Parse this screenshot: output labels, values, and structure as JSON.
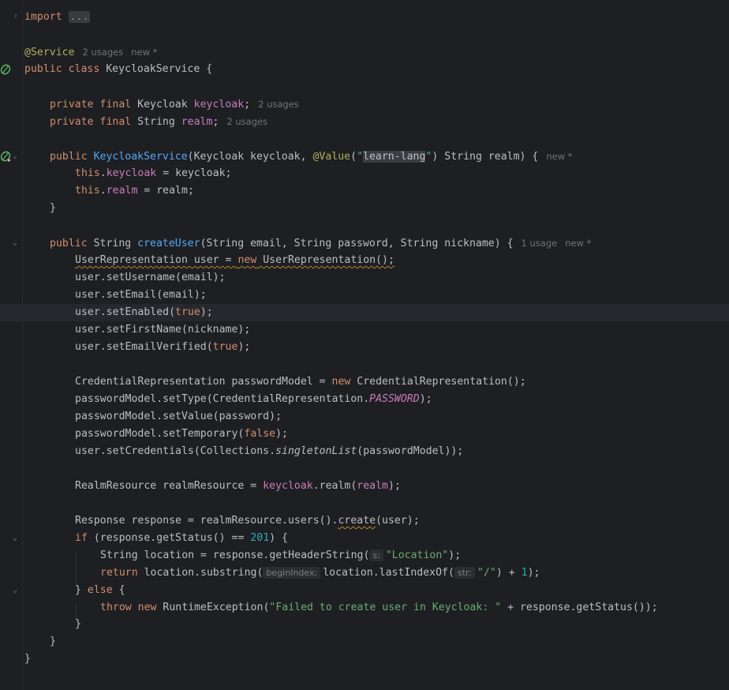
{
  "editor": {
    "hints": {
      "service_usages": "2 usages",
      "service_new": "new *",
      "keycloak_usages": "2 usages",
      "realm_usages": "2 usages",
      "ctor_new": "new *",
      "createuser_usages": "1 usage",
      "createuser_new": "new *"
    },
    "param_hints": {
      "s": "s:",
      "beginIndex": "beginIndex:",
      "str": "str:"
    },
    "tokens": {
      "import_kw": "import",
      "import_fold": "...",
      "service_ann": "@Service",
      "l3_a": "public class ",
      "l3_b": "KeycloakService {",
      "l5_kw": "private final ",
      "l5_type": "Keycloak ",
      "l5_field": "keycloak",
      "l5_end": ";",
      "l6_kw": "private final ",
      "l6_type": "String ",
      "l6_field": "realm",
      "l6_end": ";",
      "l8_kw": "public ",
      "l8_fn": "KeycloakService",
      "l8_b": "(Keycloak keycloak, ",
      "l8_ann": "@Value",
      "l8_c": "(",
      "l8_q1": "\"",
      "l8_str": "learn-lang",
      "l8_q2": "\"",
      "l8_d": ") String realm) {",
      "l9_kw": "this",
      "l9_dot": ".",
      "l9_field": "keycloak",
      "l9_rest": " = keycloak;",
      "l10_kw": "this",
      "l10_dot": ".",
      "l10_field": "realm",
      "l10_rest": " = realm;",
      "l11": "}",
      "l13_kw": "public ",
      "l13_type": "String ",
      "l13_fn": "createUser",
      "l13_rest": "(String email, String password, String nickname) {",
      "l14_a": "UserRepresentation user = ",
      "l14_kw": "new",
      "l14_b": " UserRepresentation();",
      "l15": "user.setUsername(email);",
      "l16": "user.setEmail(email);",
      "l17_a": "user.setEnabled(",
      "l17_kw": "true",
      "l17_b": ");",
      "l18": "user.setFirstName(nickname);",
      "l19_a": "user.setEmailVerified(",
      "l19_kw": "true",
      "l19_b": ");",
      "l21_a": "CredentialRepresentation passwordModel = ",
      "l21_kw": "new",
      "l21_b": " CredentialRepresentation();",
      "l22_a": "passwordModel.setType(CredentialRepresentation.",
      "l22_field": "PASSWORD",
      "l22_b": ");",
      "l23": "passwordModel.setValue(password);",
      "l24_a": "passwordModel.setTemporary(",
      "l24_kw": "false",
      "l24_b": ");",
      "l25_a": "user.setCredentials(Collections.",
      "l25_static": "singletonList",
      "l25_b": "(passwordModel));",
      "l27_a": "RealmResource realmResource = ",
      "l27_field": "keycloak",
      "l27_b": ".realm(",
      "l27_field2": "realm",
      "l27_c": ");",
      "l29_a": "Response response = realmResource.users().",
      "l29_sq": "create",
      "l29_b": "(user);",
      "l30_kw": "if",
      "l30_a": " (response.getStatus() == ",
      "l30_num": "201",
      "l30_b": ") {",
      "l31_a": "String location = response.getHeaderString(",
      "l31_str": "\"Location\"",
      "l31_b": ");",
      "l32_kw": "return",
      "l32_a": " location.substring(",
      "l32_b": "location.lastIndexOf(",
      "l32_str": "\"/\"",
      "l32_c": ") + ",
      "l32_num": "1",
      "l32_d": ");",
      "l33_a": "} ",
      "l33_kw": "else",
      "l33_b": " {",
      "l34_kw": "throw new",
      "l34_a": " RuntimeException(",
      "l34_str": "\"Failed to create user in Keycloak: \"",
      "l34_b": " + response.getStatus());",
      "l35": "}",
      "l36": "}",
      "l37": "}"
    }
  }
}
